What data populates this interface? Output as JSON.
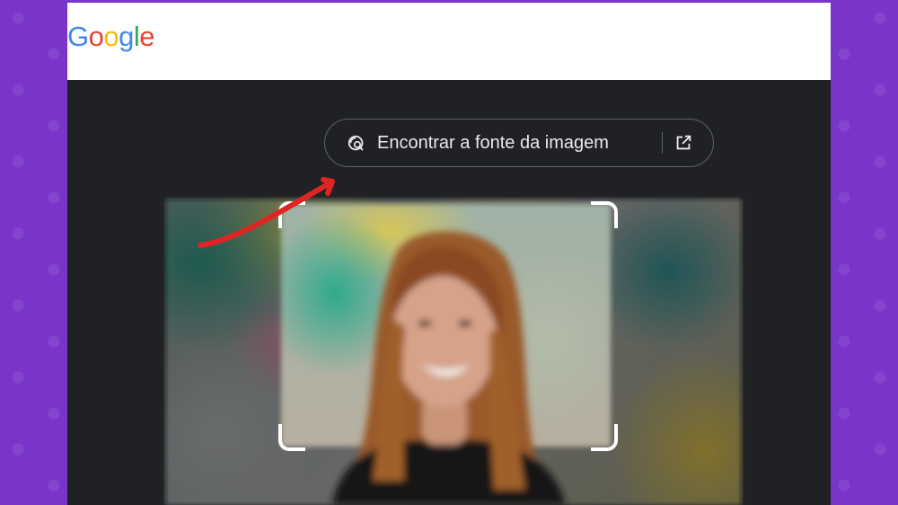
{
  "header": {
    "logo_letters": [
      "G",
      "o",
      "o",
      "g",
      "l",
      "e"
    ]
  },
  "lens": {
    "source_button_label": "Encontrar a fonte da imagem",
    "source_icon": "image-search-icon",
    "open_icon": "open-in-new-icon"
  },
  "colors": {
    "background_purple": "#7a35c8",
    "dark_surface": "#202124",
    "annotation_arrow": "#e02424"
  }
}
